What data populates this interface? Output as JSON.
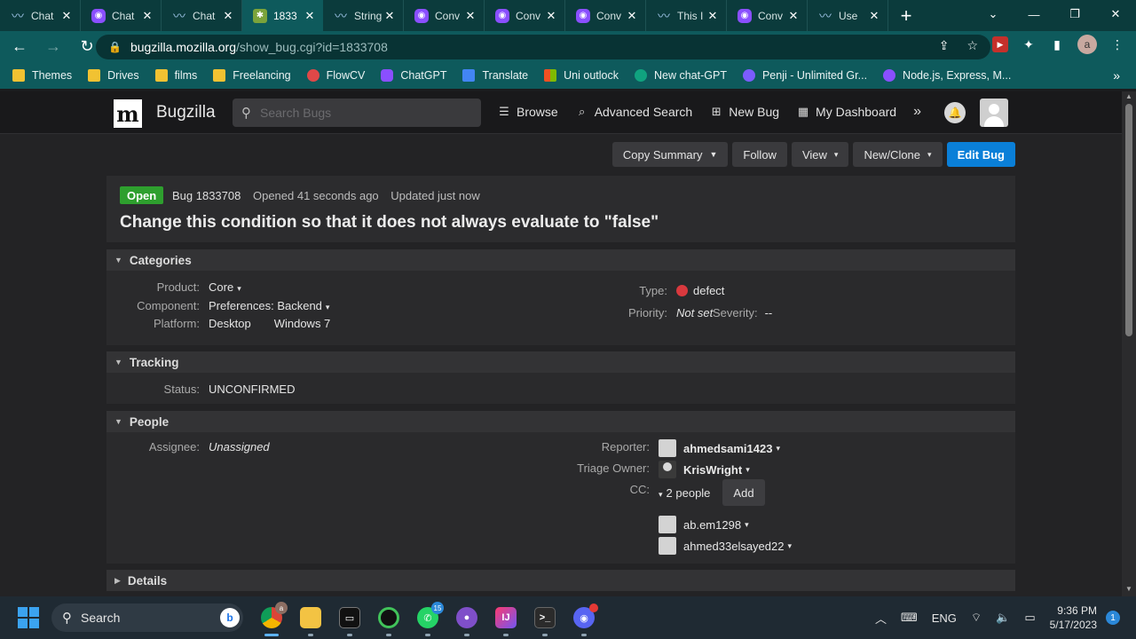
{
  "browser": {
    "tabs": [
      {
        "title": "Chat",
        "favicon": "meta-icon",
        "active": false
      },
      {
        "title": "Chat",
        "favicon": "chat-icon",
        "active": false
      },
      {
        "title": "Chat",
        "favicon": "meta-icon",
        "active": false
      },
      {
        "title": "1833",
        "favicon": "bugzilla-icon",
        "active": true
      },
      {
        "title": "String",
        "favicon": "meta-icon",
        "active": false
      },
      {
        "title": "Conv",
        "favicon": "chat-icon",
        "active": false
      },
      {
        "title": "Conv",
        "favicon": "chat-icon",
        "active": false
      },
      {
        "title": "Conv",
        "favicon": "chat-icon",
        "active": false
      },
      {
        "title": "This I",
        "favicon": "meta-icon",
        "active": false
      },
      {
        "title": "Conv",
        "favicon": "chat-icon",
        "active": false
      },
      {
        "title": "Use",
        "favicon": "meta-icon",
        "active": false
      }
    ],
    "url_host": "bugzilla.mozilla.org",
    "url_path": "/show_bug.cgi?id=1833708",
    "profile_initial": "a",
    "bookmarks": [
      {
        "label": "Themes",
        "icon": "folder"
      },
      {
        "label": "Drives",
        "icon": "folder"
      },
      {
        "label": "films",
        "icon": "folder"
      },
      {
        "label": "Freelancing",
        "icon": "folder"
      },
      {
        "label": "FlowCV",
        "icon": "flow"
      },
      {
        "label": "ChatGPT",
        "icon": "chat"
      },
      {
        "label": "Translate",
        "icon": "trans"
      },
      {
        "label": "Uni outlock",
        "icon": "ms"
      },
      {
        "label": "New chat-GPT",
        "icon": "gpt"
      },
      {
        "label": "Penji - Unlimited Gr...",
        "icon": "penji"
      },
      {
        "label": "Node.js, Express, M...",
        "icon": "node"
      }
    ]
  },
  "bugzilla": {
    "brand": "Bugzilla",
    "search_placeholder": "Search Bugs",
    "nav": {
      "browse": "Browse",
      "advanced_search": "Advanced Search",
      "new_bug": "New Bug",
      "my_dashboard": "My Dashboard"
    },
    "actions": {
      "copy_summary": "Copy Summary",
      "follow": "Follow",
      "view": "View",
      "new_clone": "New/Clone",
      "edit_bug": "Edit Bug"
    },
    "bug": {
      "status_badge": "Open",
      "id_label": "Bug 1833708",
      "opened": "Opened 41 seconds ago",
      "updated": "Updated just now",
      "title": "Change this condition so that it does not always evaluate to \"false\""
    },
    "categories": {
      "heading": "Categories",
      "product_label": "Product:",
      "product_value": "Core",
      "component_label": "Component:",
      "component_value": "Preferences: Backend",
      "platform_label": "Platform:",
      "platform_value": "Desktop",
      "os_value": "Windows 7",
      "type_label": "Type:",
      "type_value": "defect",
      "priority_label": "Priority:",
      "priority_value": "Not set",
      "severity_label": "Severity:",
      "severity_value": "--"
    },
    "tracking": {
      "heading": "Tracking",
      "status_label": "Status:",
      "status_value": "UNCONFIRMED"
    },
    "people": {
      "heading": "People",
      "assignee_label": "Assignee:",
      "assignee_value": "Unassigned",
      "reporter_label": "Reporter:",
      "reporter_value": "ahmedsami1423",
      "triage_label": "Triage Owner:",
      "triage_value": "KrisWright",
      "cc_label": "CC:",
      "cc_toggle": "2 people",
      "add_label": "Add",
      "cc_people": [
        "ab.em1298",
        "ahmed33elsayed22"
      ]
    },
    "details": {
      "heading": "Details"
    }
  },
  "taskbar": {
    "search_label": "Search",
    "language": "ENG",
    "time": "9:36 PM",
    "date": "5/17/2023",
    "notification_count": "1",
    "whatsapp_badge": "15",
    "chrome_badge": "a"
  }
}
